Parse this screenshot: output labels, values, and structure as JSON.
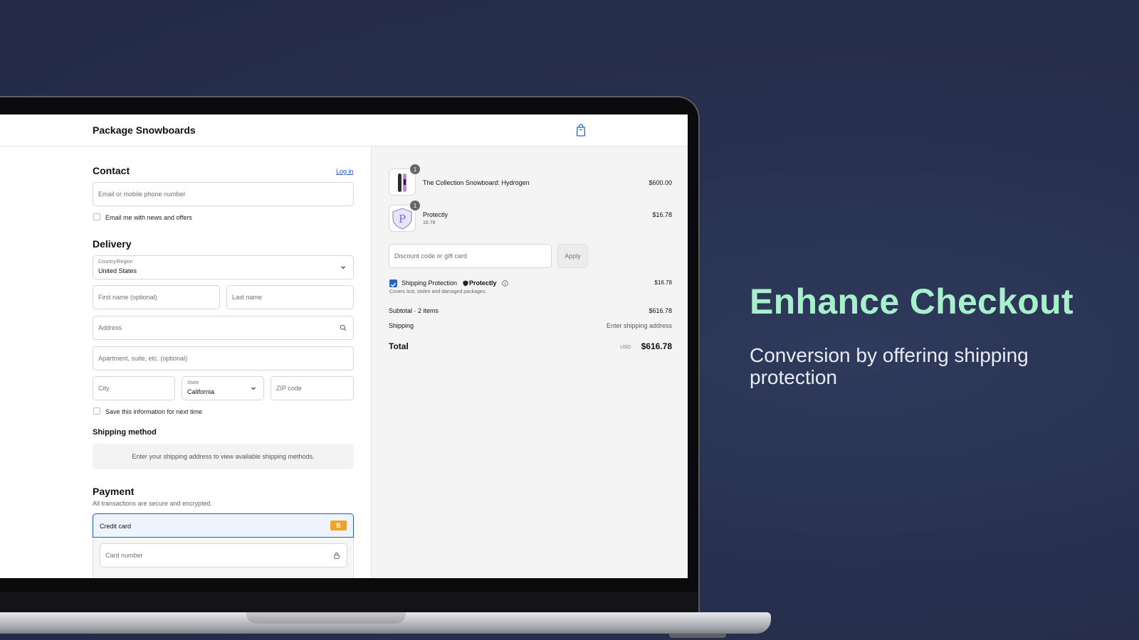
{
  "marketing": {
    "headline": "Enhance Checkout",
    "subline": "Conversion by offering shipping protection"
  },
  "header": {
    "store_name": "Package Snowboards",
    "cart_icon": "shopping-bag-icon"
  },
  "contact": {
    "title": "Contact",
    "login_link": "Log in",
    "email_placeholder": "Email or mobile phone number",
    "newsletter_label": "Email me with news and offers"
  },
  "delivery": {
    "title": "Delivery",
    "country_label": "Country/Region",
    "country_value": "United States",
    "first_name_placeholder": "First name (optional)",
    "last_name_placeholder": "Last name",
    "address_placeholder": "Address",
    "apartment_placeholder": "Apartment, suite, etc. (optional)",
    "city_placeholder": "City",
    "state_label": "State",
    "state_value": "California",
    "zip_placeholder": "ZIP code",
    "save_info_label": "Save this information for next time"
  },
  "shipping_method": {
    "title": "Shipping method",
    "notice": "Enter your shipping address to view available shipping methods."
  },
  "payment": {
    "title": "Payment",
    "subtitle": "All transactions are secure and encrypted.",
    "method_label": "Credit card",
    "method_badge": "B",
    "card_number_placeholder": "Card number"
  },
  "summary": {
    "items": [
      {
        "name": "The Collection Snowboard: Hydrogen",
        "variant": "",
        "price": "$600.00",
        "quantity": "1"
      },
      {
        "name": "Protectly",
        "variant": "16.78",
        "price": "$16.78",
        "quantity": "1"
      }
    ],
    "discount_placeholder": "Discount code or gift card",
    "apply_label": "Apply",
    "protection": {
      "label": "Shipping Protection",
      "brand": "Protectly",
      "price": "$16.78",
      "description": "Covers lost, stolen and damaged packages.",
      "checked": true
    },
    "subtotal_label": "Subtotal · 2 items",
    "subtotal_value": "$616.78",
    "shipping_label": "Shipping",
    "shipping_value": "Enter shipping address",
    "total_label": "Total",
    "currency": "USD",
    "total_value": "$616.78"
  },
  "colors": {
    "headline": "#a7f0cb",
    "accent_blue": "#2764c5",
    "badge_orange": "#f0a22e"
  }
}
